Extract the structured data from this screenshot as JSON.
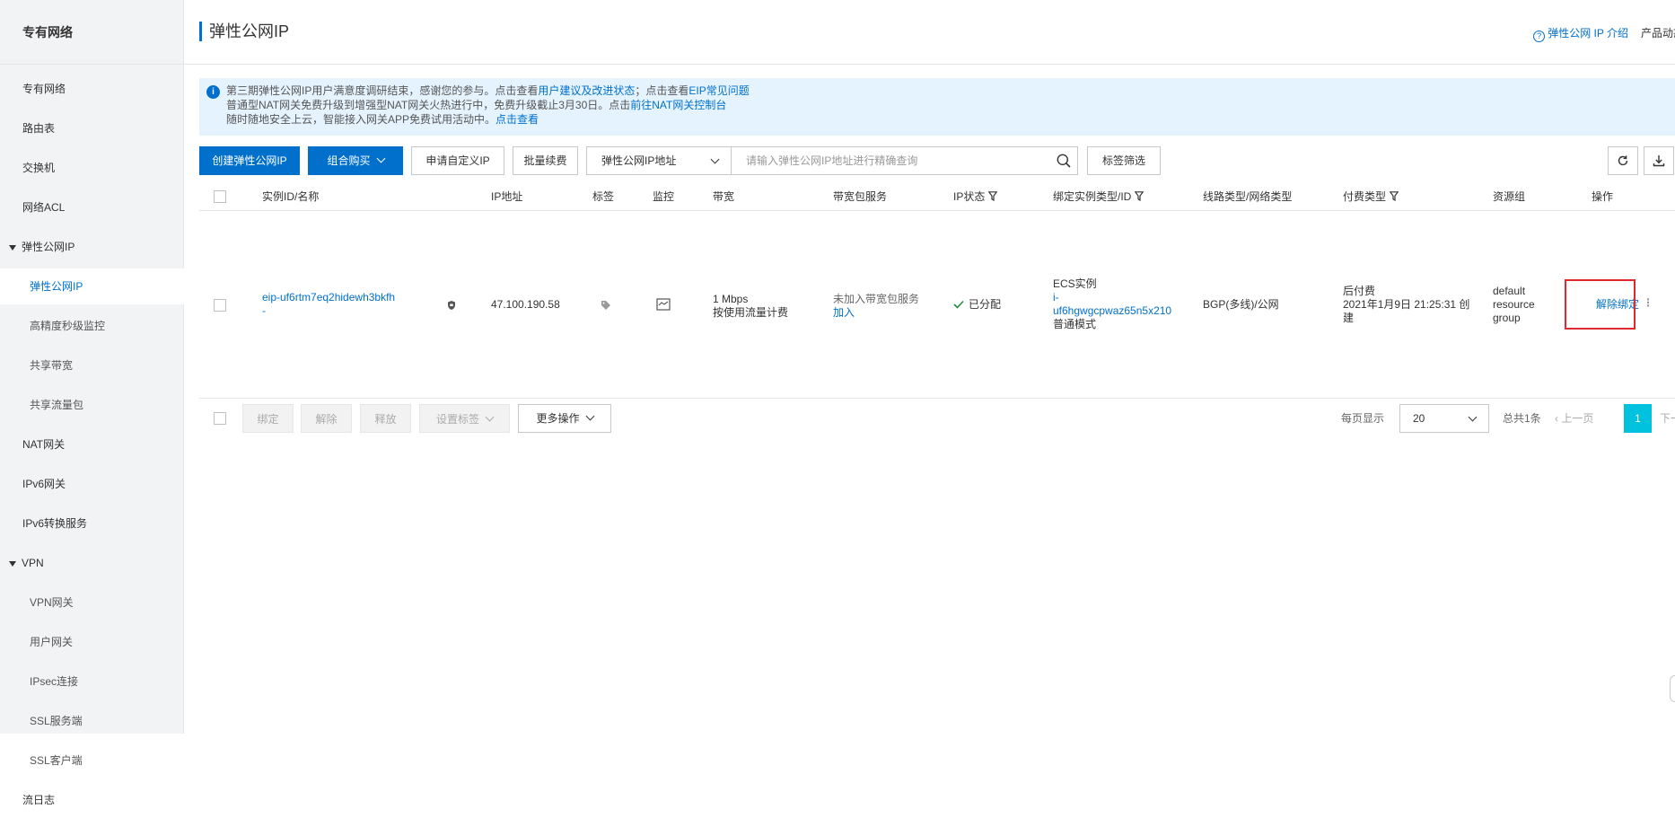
{
  "sidebar": {
    "title": "专有网络",
    "items": [
      {
        "label": "专有网络"
      },
      {
        "label": "路由表"
      },
      {
        "label": "交换机"
      },
      {
        "label": "网络ACL"
      },
      {
        "label": "弹性公网IP"
      },
      {
        "label": "弹性公网IP"
      },
      {
        "label": "高精度秒级监控"
      },
      {
        "label": "共享带宽"
      },
      {
        "label": "共享流量包"
      },
      {
        "label": "NAT网关"
      },
      {
        "label": "IPv6网关"
      },
      {
        "label": "IPv6转换服务"
      },
      {
        "label": "VPN"
      },
      {
        "label": "VPN网关"
      },
      {
        "label": "用户网关"
      },
      {
        "label": "IPsec连接"
      },
      {
        "label": "SSL服务端"
      },
      {
        "label": "SSL客户端"
      },
      {
        "label": "流日志"
      }
    ]
  },
  "header": {
    "title": "弹性公网IP",
    "intro_link": "弹性公网 IP 介绍",
    "product_link": "产品动态"
  },
  "notice": {
    "line1_text": "第三期弹性公网IP用户满意度调研结束，感谢您的参与。点击查看",
    "line1_link1": "用户建议及改进状态",
    "line1_mid": "；点击查看",
    "line1_link2": "EIP常见问题",
    "line2_text": "普通型NAT网关免费升级到增强型NAT网关火热进行中，免费升级截止3月30日。点击",
    "line2_link": "前往NAT网关控制台",
    "line3_text": "随时随地安全上云，智能接入网关APP免费试用活动中。",
    "line3_link": "点击查看"
  },
  "toolbar": {
    "create_label": "创建弹性公网IP",
    "combo_label": "组合购买",
    "custom_ip_label": "申请自定义IP",
    "batch_renew_label": "批量续费",
    "search_type_label": "弹性公网IP地址",
    "search_placeholder": "请输入弹性公网IP地址进行精确查询",
    "tag_filter_label": "标签筛选"
  },
  "table": {
    "headers": {
      "id": "实例ID/名称",
      "ip": "IP地址",
      "tag": "标签",
      "monitor": "监控",
      "bandwidth": "带宽",
      "package": "带宽包服务",
      "status": "IP状态",
      "binding": "绑定实例类型/ID",
      "line": "线路类型/网络类型",
      "pay": "付费类型",
      "group": "资源组",
      "ops": "操作"
    },
    "row": {
      "id": "eip-uf6rtm7eq2hidewh3bkfh",
      "name": "-",
      "ip": "47.100.190.58",
      "bandwidth": "1 Mbps",
      "billing": "按使用流量计费",
      "package_status": "未加入带宽包服务",
      "package_join": "加入",
      "status": "已分配",
      "instance_type": "ECS实例",
      "instance_id_1": "i-",
      "instance_id_2": "uf6hgwgcpwaz65n5x210",
      "instance_mode": "普通模式",
      "line": "BGP(多线)/公网",
      "pay_type": "后付费",
      "pay_time_1": "2021年1月9日 21:25:31 创",
      "pay_time_2": "建",
      "group_1": "default",
      "group_2": "resource",
      "group_3": "group",
      "op_unbind": "解除绑定"
    }
  },
  "footer": {
    "bind": "绑定",
    "unbind": "解除",
    "release": "释放",
    "set_tag": "设置标签",
    "more": "更多操作",
    "per_page_label": "每页显示",
    "per_page_value": "20",
    "total": "总共1条",
    "prev": "上一页",
    "page": "1",
    "next": "下一页"
  },
  "colors": {
    "primary": "#0070cc",
    "highlight": "#e0282e",
    "page_active": "#00c1de",
    "success": "#1e8e3e"
  }
}
